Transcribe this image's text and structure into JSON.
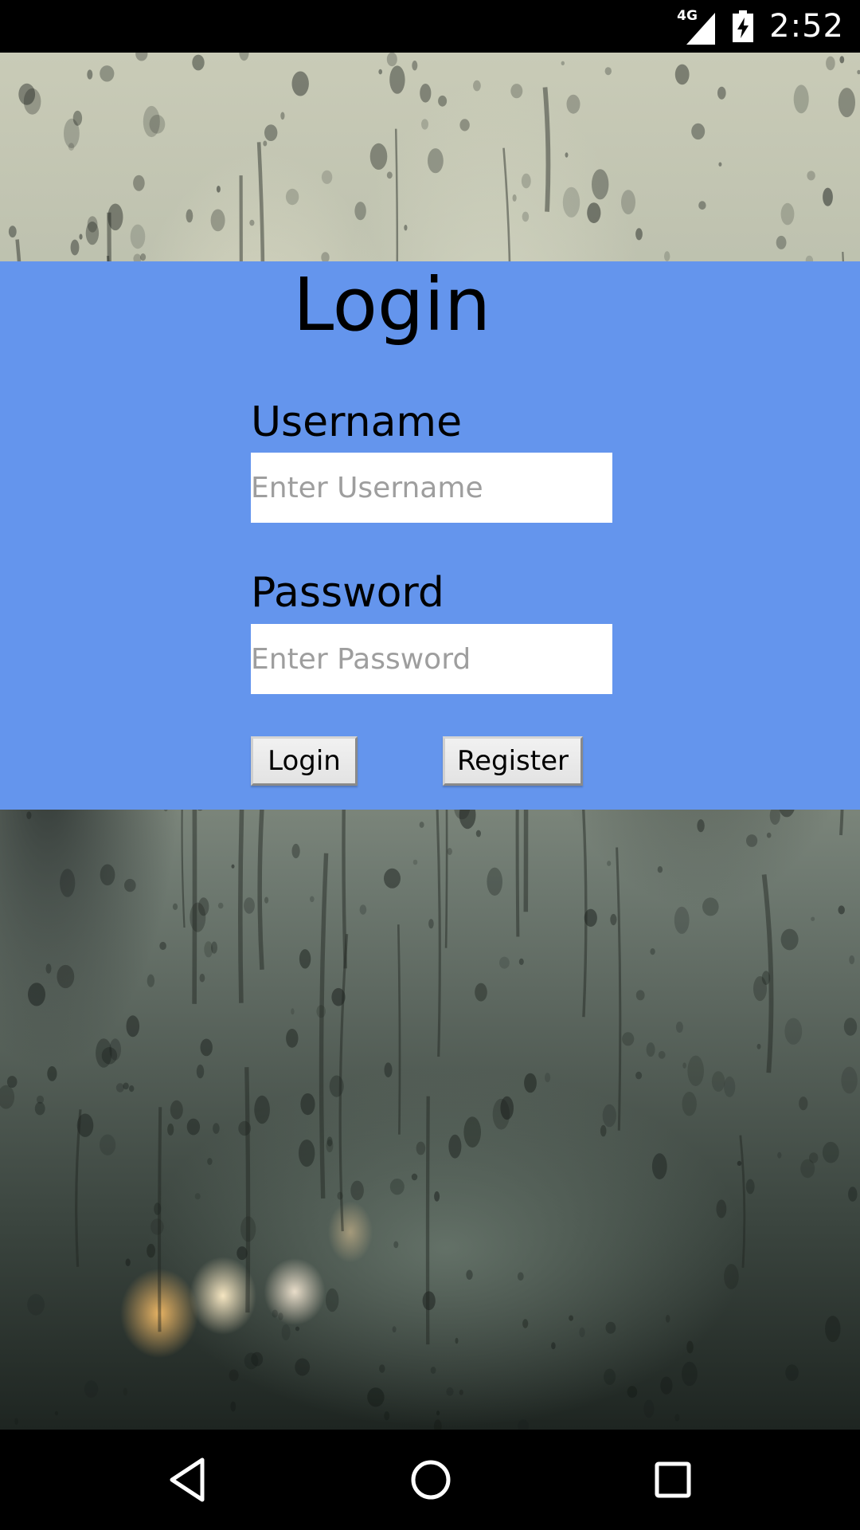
{
  "status_bar": {
    "network": "4G",
    "time": "2:52",
    "icons": [
      "signal-icon",
      "battery-charging-icon"
    ]
  },
  "login_form": {
    "title": "Login",
    "username_label": "Username",
    "username_placeholder": "Enter Username",
    "username_value": "",
    "password_label": "Password",
    "password_placeholder": "Enter Password",
    "password_value": "",
    "login_button": "Login",
    "register_button": "Register"
  },
  "nav_bar": {
    "icons": [
      "back-icon",
      "home-icon",
      "recent-apps-icon"
    ]
  },
  "colors": {
    "panel_background": "#6495ed",
    "status_bar": "#000000",
    "nav_bar": "#000000",
    "input_background": "#ffffff",
    "placeholder_text": "#9e9e9e"
  }
}
